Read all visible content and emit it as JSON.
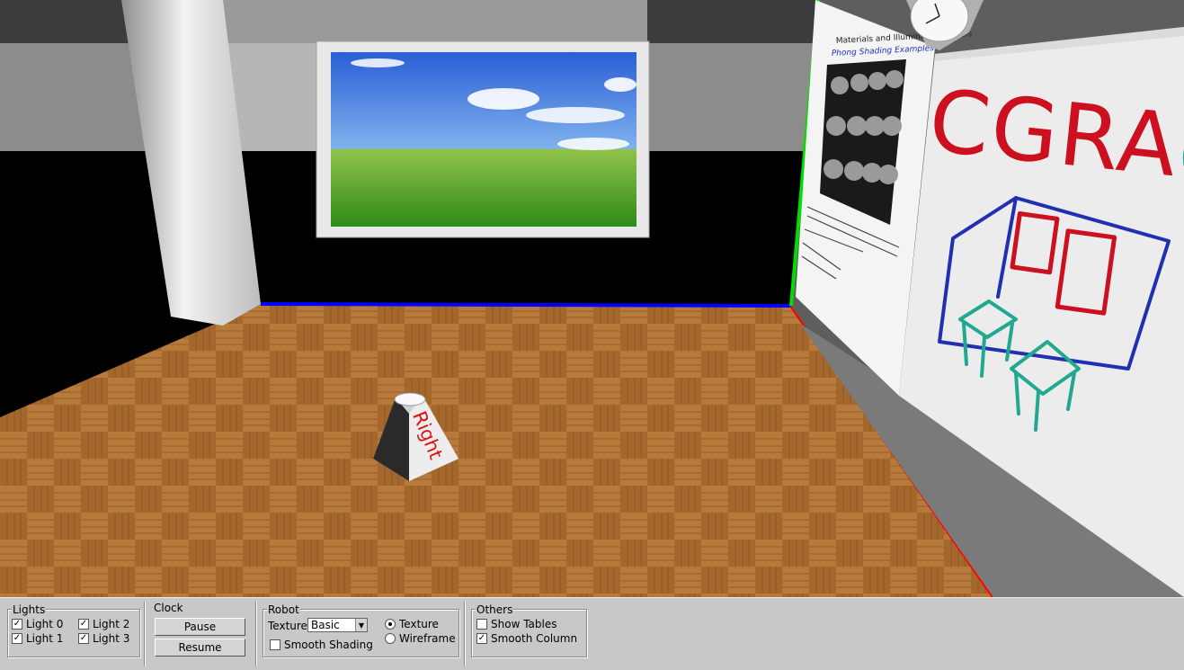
{
  "scene": {
    "robot_label": "Right",
    "whiteboard_text": "CGRA@FE",
    "poster_title": "Materials and Illumination Models",
    "poster_subtitle": "Phong Shading Examples"
  },
  "panel": {
    "lights": {
      "title": "Lights",
      "items": [
        {
          "label": "Light 0",
          "checked": true
        },
        {
          "label": "Light 2",
          "checked": true
        },
        {
          "label": "Light 1",
          "checked": true
        },
        {
          "label": "Light 3",
          "checked": true
        }
      ]
    },
    "clock": {
      "title": "Clock",
      "pause_label": "Pause",
      "resume_label": "Resume"
    },
    "robot": {
      "title": "Robot",
      "texture_label": "Texture",
      "texture_value": "Basic",
      "smooth_shading_label": "Smooth Shading",
      "smooth_shading_checked": false,
      "mode_texture_label": "Texture",
      "mode_wireframe_label": "Wireframe",
      "mode_selected": "Texture"
    },
    "others": {
      "title": "Others",
      "show_tables_label": "Show Tables",
      "show_tables_checked": false,
      "smooth_column_label": "Smooth Column",
      "smooth_column_checked": true
    }
  },
  "colors": {
    "axis_x": "#ff0000",
    "axis_y": "#00cc00",
    "axis_z": "#0000ff",
    "panel_bg": "#c8c8c8",
    "whiteboard_red": "#cc1020",
    "whiteboard_blue": "#2030b0",
    "whiteboard_teal": "#20a890"
  }
}
